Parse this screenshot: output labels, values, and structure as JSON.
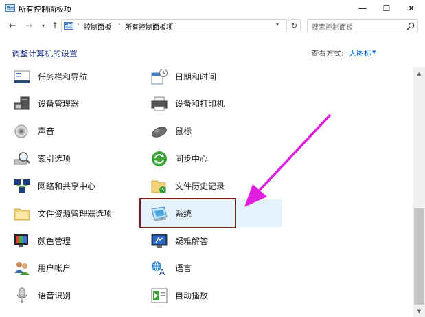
{
  "window": {
    "title": "所有控制面板项",
    "minimize": "—",
    "maximize": "☐",
    "close": "✕"
  },
  "nav": {
    "back": "←",
    "forward": "→",
    "dropdown": "▾",
    "up": "↑",
    "refresh": "↻",
    "breadcrumb": [
      "控制面板",
      "所有控制面板项"
    ],
    "breadcrumb_separator": "›",
    "address_dropdown": "▾",
    "search_placeholder": "搜索控制面板"
  },
  "header": {
    "title": "调整计算机的设置",
    "view_label": "查看方式:",
    "view_value": "大图标",
    "view_caret": "▼"
  },
  "scrollbar": {
    "up": "▲",
    "down": "▼"
  },
  "items_left": [
    {
      "label": "任务栏和导航",
      "icon": "taskbar-icon"
    },
    {
      "label": "设备管理器",
      "icon": "device-manager-icon"
    },
    {
      "label": "声音",
      "icon": "sound-icon"
    },
    {
      "label": "索引选项",
      "icon": "indexing-icon"
    },
    {
      "label": "网络和共享中心",
      "icon": "network-icon"
    },
    {
      "label": "文件资源管理器选项",
      "icon": "folder-options-icon"
    },
    {
      "label": "颜色管理",
      "icon": "color-management-icon"
    },
    {
      "label": "用户帐户",
      "icon": "user-accounts-icon"
    },
    {
      "label": "语音识别",
      "icon": "microphone-icon"
    }
  ],
  "items_right": [
    {
      "label": "日期和时间",
      "icon": "date-time-icon"
    },
    {
      "label": "设备和打印机",
      "icon": "printer-icon"
    },
    {
      "label": "鼠标",
      "icon": "mouse-icon"
    },
    {
      "label": "同步中心",
      "icon": "sync-icon"
    },
    {
      "label": "文件历史记录",
      "icon": "file-history-icon"
    },
    {
      "label": "系统",
      "icon": "system-icon"
    },
    {
      "label": "疑难解答",
      "icon": "troubleshooting-icon"
    },
    {
      "label": "语言",
      "icon": "language-icon"
    },
    {
      "label": "自动播放",
      "icon": "autoplay-icon"
    }
  ],
  "colors": {
    "accent_link": "#0066cc",
    "header_text": "#1e3287",
    "highlight_border": "#7a1c1c",
    "annotation_arrow": "#e01de0",
    "selection_bg": "#e5f1fb"
  }
}
